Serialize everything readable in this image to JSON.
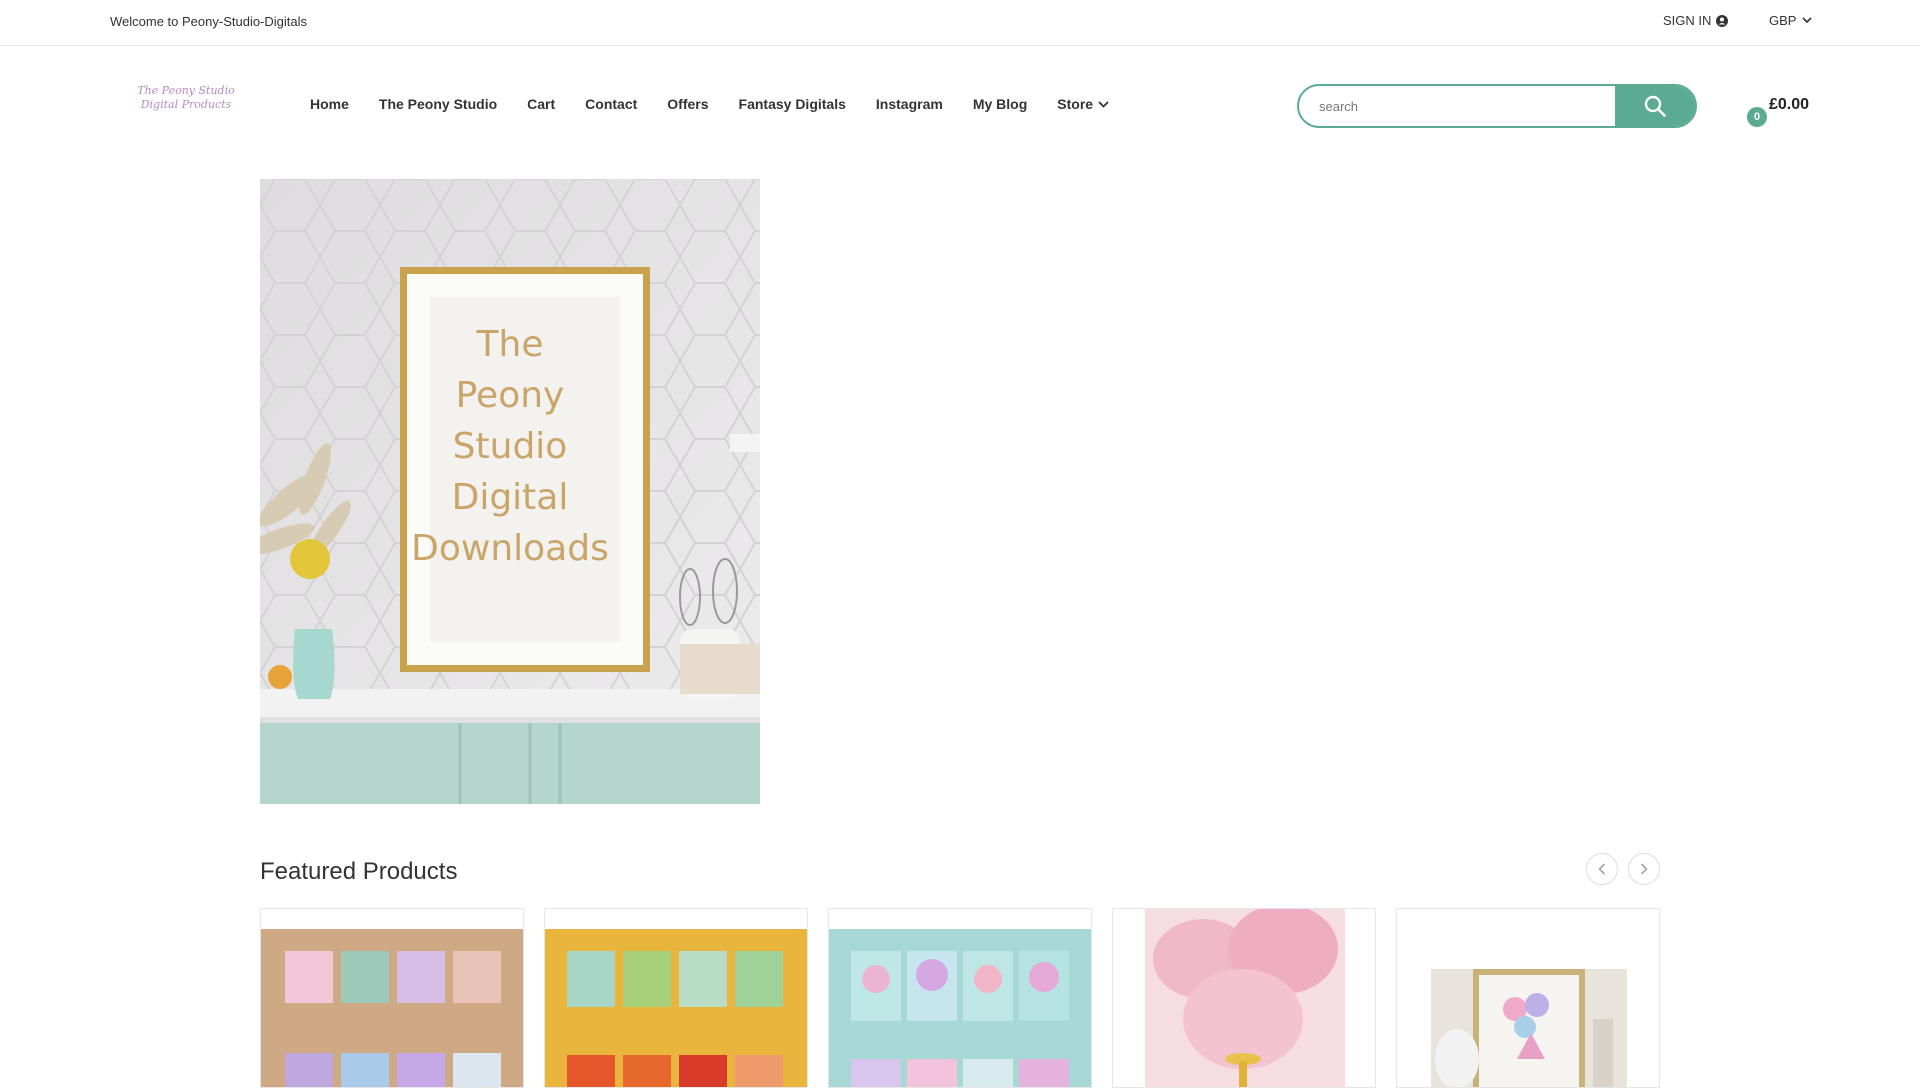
{
  "topbar": {
    "welcome": "Welcome to Peony-Studio-Digitals",
    "signin": "SIGN IN",
    "currency": "GBP"
  },
  "logo": {
    "line1": "The Peony Studio",
    "line2": "Digital Products"
  },
  "nav": [
    {
      "label": "Home"
    },
    {
      "label": "The Peony Studio"
    },
    {
      "label": "Cart"
    },
    {
      "label": "Contact"
    },
    {
      "label": "Offers"
    },
    {
      "label": "Fantasy Digitals"
    },
    {
      "label": "Instagram"
    },
    {
      "label": "My Blog"
    },
    {
      "label": "Store"
    }
  ],
  "search": {
    "placeholder": "search"
  },
  "cart": {
    "count": "0",
    "total": "£0.00"
  },
  "hero": {
    "frame_text": [
      "The",
      "Peony",
      "Studio",
      "Digital",
      "Downloads"
    ]
  },
  "featured": {
    "title": "Featured Products"
  },
  "colors": {
    "accent": "#5aab91"
  }
}
